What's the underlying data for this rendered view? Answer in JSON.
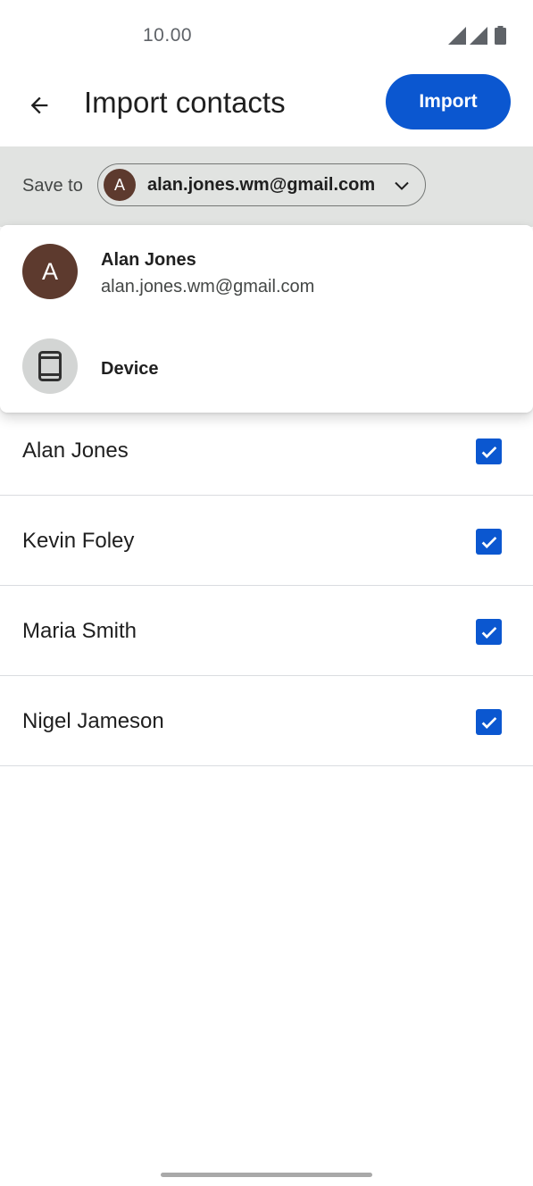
{
  "status_bar": {
    "time": "10.00",
    "icons": [
      "signal-icon",
      "signal-icon",
      "battery-icon"
    ]
  },
  "app_bar": {
    "back_icon": "arrow-left-icon",
    "title": "Import contacts",
    "import_label": "Import"
  },
  "save_to": {
    "label": "Save to",
    "selected_avatar_initial": "A",
    "selected_account": "alan.jones.wm@gmail.com",
    "chevron_icon": "chevron-down-icon"
  },
  "dropdown": {
    "items": [
      {
        "avatar_initial": "A",
        "name": "Alan Jones",
        "email": "alan.jones.wm@gmail.com"
      },
      {
        "icon": "phone-icon",
        "name": "Device"
      }
    ]
  },
  "contacts": [
    {
      "name": "Alan Jones",
      "checked": true
    },
    {
      "name": "Kevin Foley",
      "checked": true
    },
    {
      "name": "Maria Smith",
      "checked": true
    },
    {
      "name": "Nigel Jameson",
      "checked": true
    }
  ],
  "colors": {
    "accent": "#0b57d0",
    "avatar": "#5d3a2e",
    "band": "#e1e3e1"
  }
}
